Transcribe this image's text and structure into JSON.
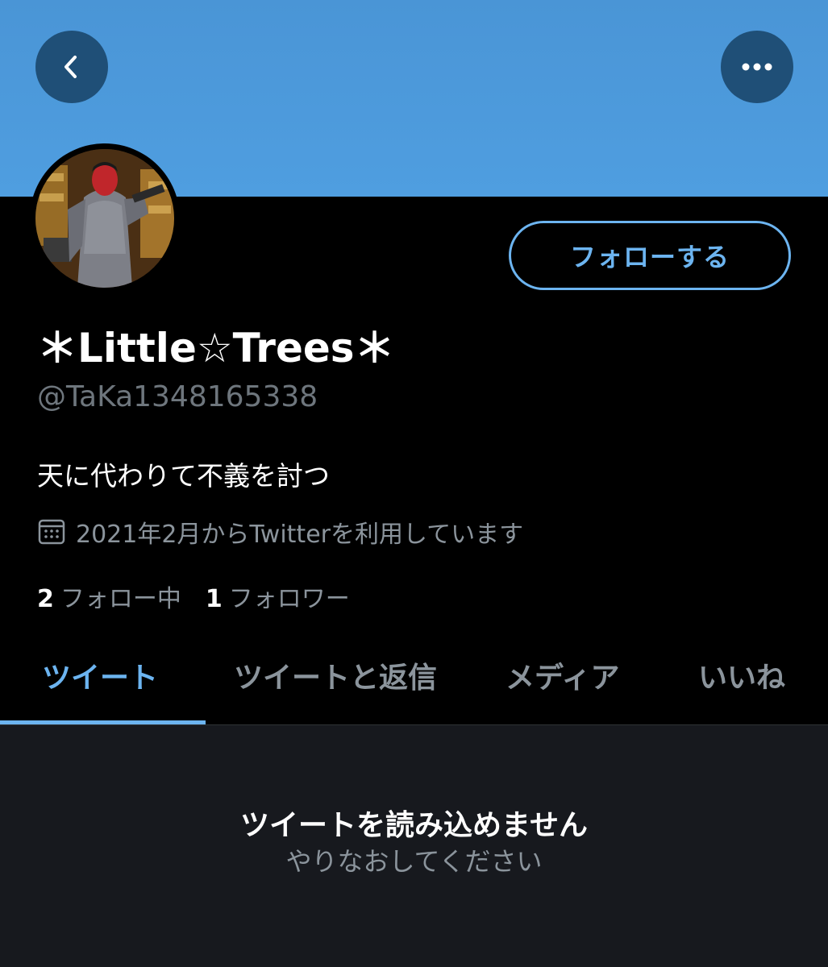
{
  "header": {
    "back_icon": "chevron-left-icon",
    "more_icon": "ellipsis-icon",
    "banner_color": "#4f9ee0"
  },
  "profile": {
    "display_name": "＊Little☆Trees＊",
    "handle": "@TaKa1348165338",
    "bio": "天に代わりて不義を討つ",
    "joined": "2021年2月からTwitterを利用しています",
    "follow_button": "フォローする"
  },
  "stats": {
    "following_count": "2",
    "following_label": "フォロー中",
    "followers_count": "1",
    "followers_label": "フォロワー"
  },
  "tabs": [
    {
      "label": "ツイート",
      "active": true
    },
    {
      "label": "ツイートと返信",
      "active": false
    },
    {
      "label": "メディア",
      "active": false
    },
    {
      "label": "いいね",
      "active": false
    }
  ],
  "error": {
    "title": "ツイートを読み込めません",
    "subtitle": "やりなおしてください"
  },
  "colors": {
    "accent": "#6cb4f0",
    "background": "#000000",
    "muted_text": "#8b949c"
  }
}
